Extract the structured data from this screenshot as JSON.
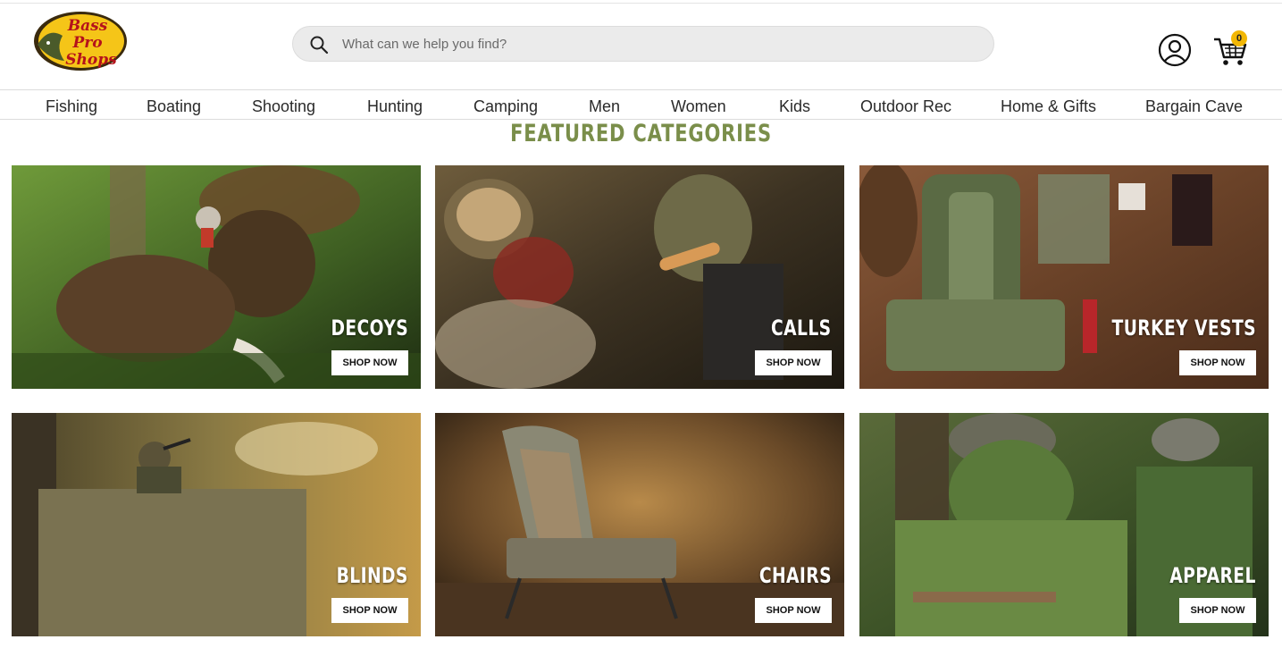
{
  "header": {
    "logo_text": [
      "Bass",
      "Pro",
      "Shops"
    ],
    "search": {
      "placeholder": "What can we help you find?"
    },
    "cart_count": "0"
  },
  "nav": {
    "items": [
      "Fishing",
      "Boating",
      "Shooting",
      "Hunting",
      "Camping",
      "Men",
      "Women",
      "Kids",
      "Outdoor Rec",
      "Home & Gifts",
      "Bargain Cave"
    ]
  },
  "featured": {
    "title": "FEATURED CATEGORIES",
    "tiles": [
      {
        "label": "DECOYS",
        "button": "SHOP NOW"
      },
      {
        "label": "CALLS",
        "button": "SHOP NOW"
      },
      {
        "label": "TURKEY VESTS",
        "button": "SHOP NOW"
      },
      {
        "label": "BLINDS",
        "button": "SHOP NOW"
      },
      {
        "label": "CHAIRS",
        "button": "SHOP NOW"
      },
      {
        "label": "APPAREL",
        "button": "SHOP NOW"
      }
    ]
  },
  "colors": {
    "title_green": "#7a8e4a",
    "cart_badge": "#f2b705",
    "logo_yellow": "#f5c518",
    "logo_red": "#b5121b"
  },
  "icons": {
    "search": "search-icon",
    "account": "account-icon",
    "cart": "cart-icon"
  }
}
